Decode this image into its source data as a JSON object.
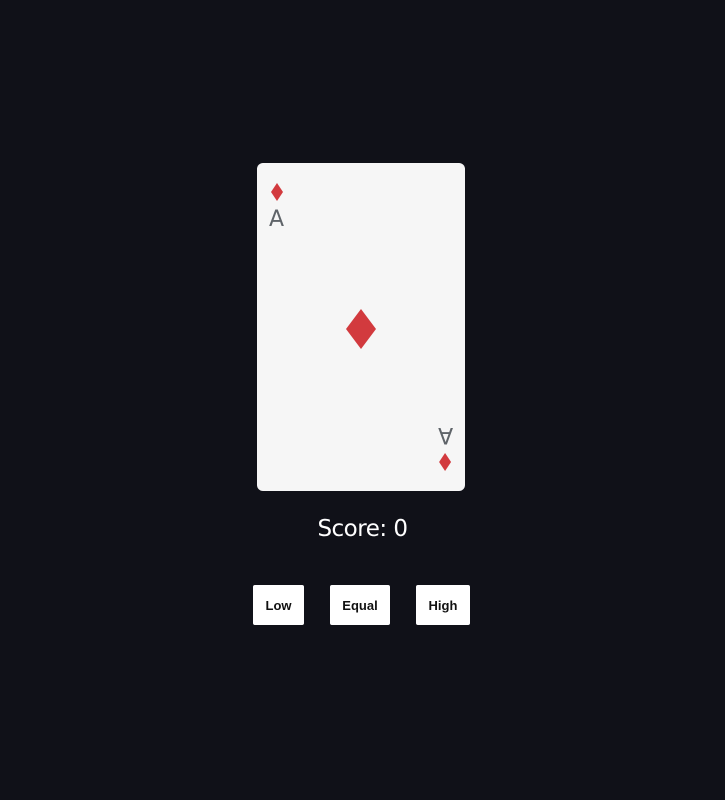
{
  "card": {
    "rank": "A",
    "suit": "diamonds",
    "suit_icon": "diamond-icon",
    "suit_color": "#d23a3e",
    "rank_color": "#5f6469",
    "face_color": "#f6f6f6"
  },
  "score": {
    "text": "Score: 0",
    "value": 0
  },
  "buttons": {
    "low": "Low",
    "equal": "Equal",
    "high": "High"
  },
  "colors": {
    "background": "#101118"
  }
}
